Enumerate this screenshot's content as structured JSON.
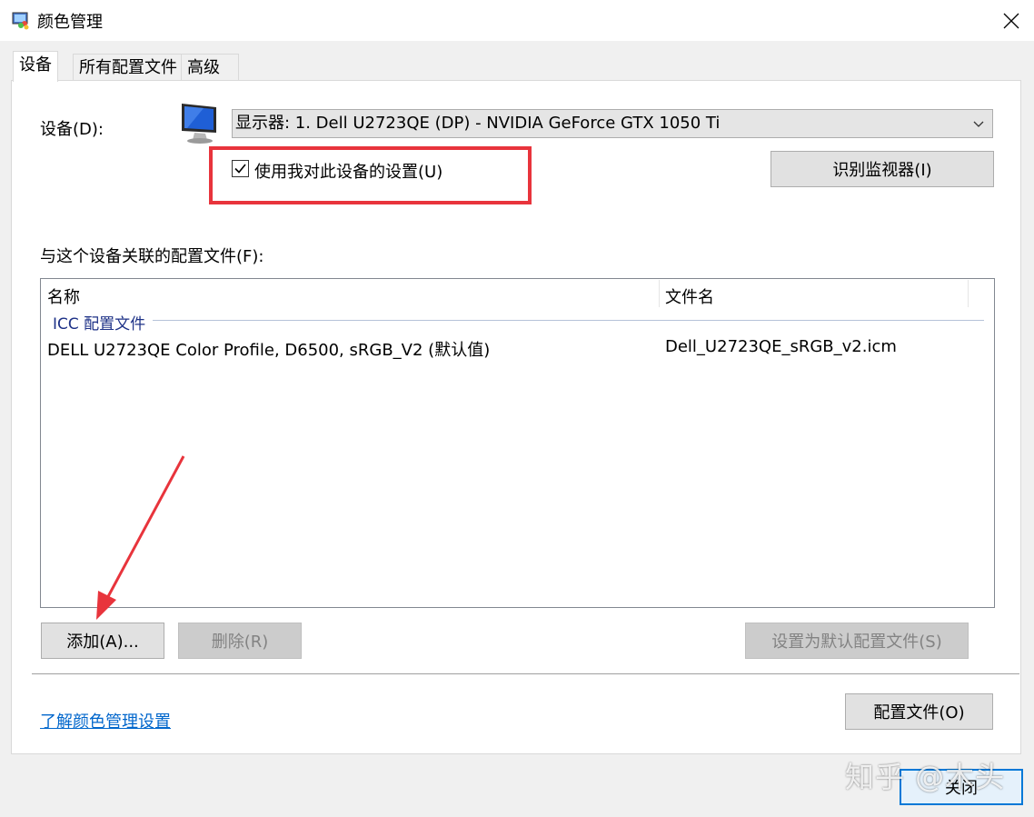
{
  "window": {
    "title": "颜色管理"
  },
  "tabs": [
    {
      "label": "设备",
      "active": true
    },
    {
      "label": "所有配置文件",
      "active": false
    },
    {
      "label": "高级",
      "active": false
    }
  ],
  "device": {
    "label": "设备(D):",
    "selected": "显示器: 1. Dell U2723QE (DP) - NVIDIA GeForce GTX 1050 Ti",
    "use_settings_label": "使用我对此设备的设置(U)",
    "use_settings_checked": true,
    "identify_button": "识别监视器(I)"
  },
  "profiles": {
    "label": "与这个设备关联的配置文件(F):",
    "columns": [
      "名称",
      "文件名"
    ],
    "group": "ICC 配置文件",
    "rows": [
      {
        "name": "DELL U2723QE Color Profile, D6500, sRGB_V2 (默认值)",
        "file": "Dell_U2723QE_sRGB_v2.icm"
      }
    ]
  },
  "buttons": {
    "add": "添加(A)...",
    "delete": "删除(R)",
    "set_default": "设置为默认配置文件(S)",
    "profiles": "配置文件(O)",
    "close": "关闭"
  },
  "link": "了解颜色管理设置",
  "watermark": "知乎 @木头",
  "colors": {
    "highlight": "#e8343c",
    "link": "#0066cc",
    "group": "#1e3287"
  }
}
